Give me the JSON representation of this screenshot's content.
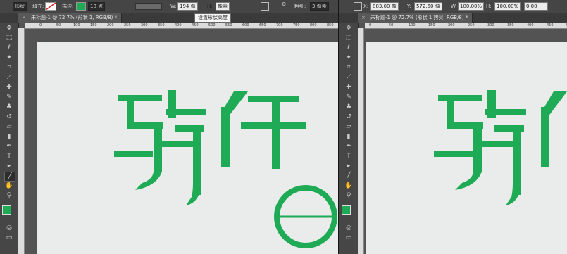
{
  "left": {
    "options": {
      "mode_value": "形状",
      "fill_label": "填充:",
      "stroke_label": "描边:",
      "stroke_width_value": "18 点",
      "width_label": "W:",
      "width_value": "194 像",
      "height_label": "H:",
      "height_value": "像素",
      "tooltip": "设置形状高度",
      "align_label": "粗细:",
      "align_value": "3 像素"
    },
    "tab": {
      "close": "×",
      "title": "未标题-1 @ 72.7% (形状 1, RGB/8) *"
    },
    "ruler_ticks": [
      "0",
      "50",
      "100",
      "150",
      "200",
      "250",
      "300",
      "350",
      "400",
      "450",
      "500",
      "550",
      "600",
      "650",
      "700",
      "750",
      "800",
      "850",
      "900"
    ]
  },
  "right": {
    "options": {
      "x_label": "X:",
      "x_value": "883.00 像",
      "y_label": "Y:",
      "y_value": "572.50 像",
      "w_label": "W:",
      "w_value": "100.00%",
      "h_label": "H:",
      "h_value": "100.00%",
      "angle_value": "0.00"
    },
    "tab": {
      "close": "×",
      "title": "未标题-1 @ 72.7% (形状 1 拷贝, RGB/8) *"
    },
    "ruler_ticks": [
      "0",
      "50",
      "100",
      "150",
      "200",
      "250",
      "300",
      "350",
      "400",
      "450",
      "500"
    ]
  },
  "colors": {
    "logo_green": "#1fab56",
    "canvas": "#e9ecea",
    "ui_dark": "#535353"
  }
}
